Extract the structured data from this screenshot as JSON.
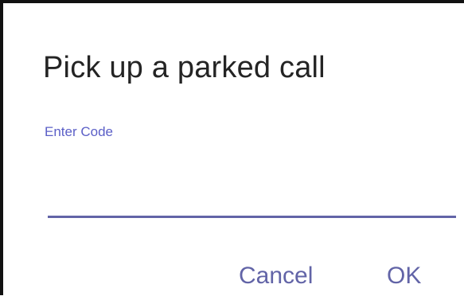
{
  "dialog": {
    "title": "Pick up a parked call",
    "field": {
      "label": "Enter Code",
      "value": "",
      "placeholder": ""
    },
    "buttons": {
      "cancel_label": "Cancel",
      "ok_label": "OK"
    }
  },
  "colors": {
    "accent": "#6264a7",
    "label": "#5b5fc7",
    "title_text": "#242424",
    "background": "#ffffff"
  }
}
